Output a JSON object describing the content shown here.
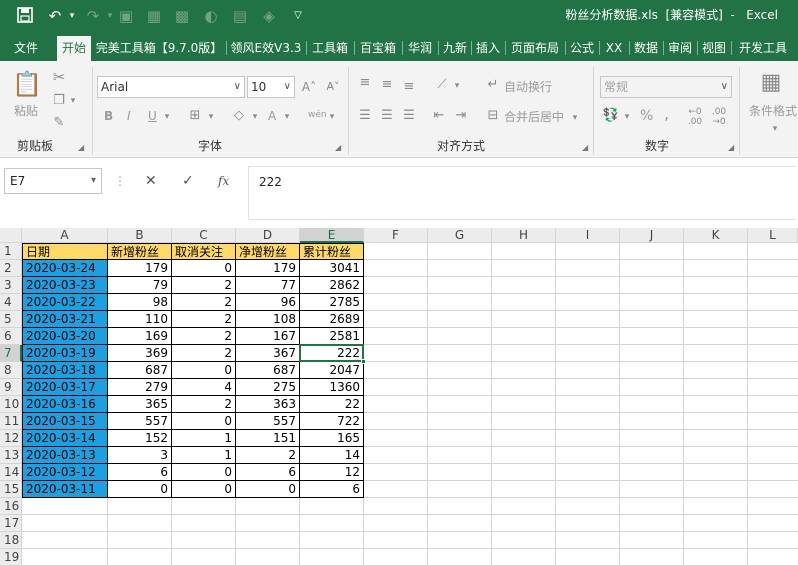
{
  "title_bar": {
    "title": "粉丝分析数据.xls  [兼容模式]  -   Excel",
    "icons": [
      "save-icon",
      "undo-icon",
      "redo-icon",
      "form-icon",
      "table-icon",
      "freeze-icon",
      "circle-icon",
      "grid-icon",
      "clear-icon",
      "customize-icon"
    ]
  },
  "tabs": [
    {
      "label": "文件"
    },
    {
      "label": "开始"
    },
    {
      "label": "完美工具箱【9.7.0版】"
    },
    {
      "label": "领风E效V3.3"
    },
    {
      "label": "工具箱"
    },
    {
      "label": "百宝箱"
    },
    {
      "label": "华润"
    },
    {
      "label": "九新"
    },
    {
      "label": "插入"
    },
    {
      "label": "页面布局"
    },
    {
      "label": "公式"
    },
    {
      "label": "XX"
    },
    {
      "label": "数据"
    },
    {
      "label": "审阅"
    },
    {
      "label": "视图"
    },
    {
      "label": "开发工具"
    }
  ],
  "ribbon": {
    "clipboard": {
      "paste": "粘贴",
      "label": "剪贴板"
    },
    "font": {
      "name": "Arial",
      "size": "10",
      "label": "字体",
      "bold": "B",
      "italic": "I",
      "underline": "U",
      "font_color": "A",
      "wen": "wén"
    },
    "alignment": {
      "wrap": "自动换行",
      "merge": "合并后居中",
      "label": "对齐方式"
    },
    "number": {
      "format": "常规",
      "label": "数字",
      "percent": "%",
      "comma": ","
    },
    "styles": {
      "conditional": "条件格式"
    }
  },
  "formula_bar": {
    "cell_ref": "E7",
    "fx": "fx",
    "content": "222"
  },
  "columns": [
    "A",
    "B",
    "C",
    "D",
    "E",
    "F",
    "G",
    "H",
    "I",
    "J",
    "K",
    "L"
  ],
  "rows": [
    "1",
    "2",
    "3",
    "4",
    "5",
    "6",
    "7",
    "8",
    "9",
    "10",
    "11",
    "12",
    "13",
    "14",
    "15",
    "16",
    "17",
    "18",
    "19"
  ],
  "sheet": {
    "headers": [
      "日期",
      "新增粉丝",
      "取消关注",
      "净增粉丝",
      "累计粉丝"
    ],
    "data": [
      [
        "2020-03-24",
        "179",
        "0",
        "179",
        "3041"
      ],
      [
        "2020-03-23",
        "79",
        "2",
        "77",
        "2862"
      ],
      [
        "2020-03-22",
        "98",
        "2",
        "96",
        "2785"
      ],
      [
        "2020-03-21",
        "110",
        "2",
        "108",
        "2689"
      ],
      [
        "2020-03-20",
        "169",
        "2",
        "167",
        "2581"
      ],
      [
        "2020-03-19",
        "369",
        "2",
        "367",
        "222"
      ],
      [
        "2020-03-18",
        "687",
        "0",
        "687",
        "2047"
      ],
      [
        "2020-03-17",
        "279",
        "4",
        "275",
        "1360"
      ],
      [
        "2020-03-16",
        "365",
        "2",
        "363",
        "22"
      ],
      [
        "2020-03-15",
        "557",
        "0",
        "557",
        "722"
      ],
      [
        "2020-03-14",
        "152",
        "1",
        "151",
        "165"
      ],
      [
        "2020-03-13",
        "3",
        "1",
        "2",
        "14"
      ],
      [
        "2020-03-12",
        "6",
        "0",
        "6",
        "12"
      ],
      [
        "2020-03-11",
        "0",
        "0",
        "0",
        "6"
      ]
    ],
    "active_cell": "E7"
  },
  "colors": {
    "excel_green": "#217346",
    "header_fill": "#ffd966",
    "date_fill": "#1ba1e2"
  }
}
